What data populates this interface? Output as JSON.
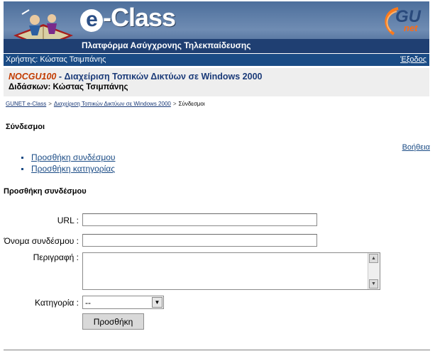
{
  "header": {
    "brand": "e-Class",
    "brand_e": "e",
    "brand_rest": "-Class",
    "subtitle": "Πλατφόρμα Ασύγχρονης Τηλεκπαίδευσης",
    "partner_logo_gu": "GU",
    "partner_logo_net": "net"
  },
  "userbar": {
    "user_text": "Χρήστης: Κώστας Τσιμπάνης",
    "logout": "Έξοδος"
  },
  "course": {
    "code": "NOCGU100",
    "title": " - Διαχείριση Τοπικών Δικτύων σε Windows 2000",
    "teacher": "Διδάσκων: Κώστας Τσιμπάνης"
  },
  "breadcrumb": {
    "home": "GUNET e-Class",
    "course": "Διαχείριση Τοπικών Δικτύων σε Windows 2000",
    "current": "Σύνδεσμοι",
    "sep": ">"
  },
  "page": {
    "title": "Σύνδεσμοι",
    "help": "Βοήθεια",
    "actions": [
      "Προσθήκη συνδέσμου",
      "Προσθήκη κατηγορίας"
    ]
  },
  "form": {
    "title": "Προσθήκη συνδέσμου",
    "url_label": "URL :",
    "url_value": "",
    "name_label": "Όνομα συνδέσμου :",
    "name_value": "",
    "desc_label": "Περιγραφή :",
    "category_label": "Κατηγορία :",
    "category_value": "--",
    "submit": "Προσθήκη"
  },
  "colors": {
    "header_strip": "#1f3f72",
    "userbar": "#1a4b85",
    "course_code": "#c23b00",
    "link": "#1a4b85"
  }
}
